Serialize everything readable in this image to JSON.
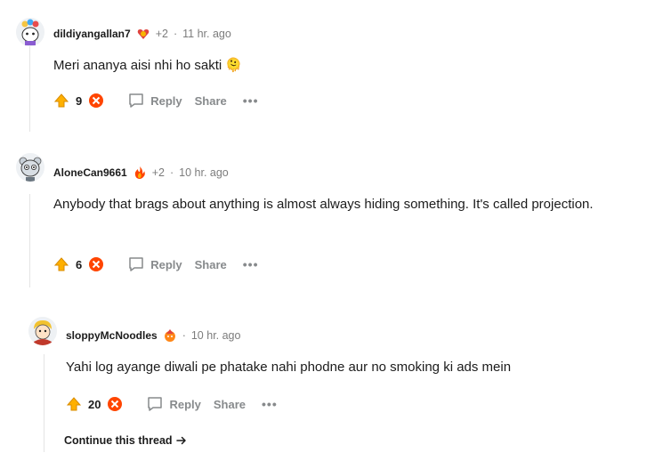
{
  "comments": [
    {
      "username": "dildiyangallan7",
      "award_extra": "+2",
      "separator": "·",
      "time": "11 hr. ago",
      "body": "Meri ananya aisi nhi ho sakti 🫠",
      "votes": "9",
      "reply_label": "Reply",
      "share_label": "Share",
      "more_label": "•••"
    },
    {
      "username": "AloneCan9661",
      "award_extra": "+2",
      "separator": "·",
      "time": "10 hr. ago",
      "body": "Anybody that brags about anything is almost always hiding something. It's called projection.",
      "votes": "6",
      "reply_label": "Reply",
      "share_label": "Share",
      "more_label": "•••"
    },
    {
      "username": "sloppyMcNoodles",
      "separator": "·",
      "time": "10 hr. ago",
      "body": "Yahi log ayange diwali pe phatake nahi phodne aur no smoking ki ads mein",
      "votes": "20",
      "reply_label": "Reply",
      "share_label": "Share",
      "more_label": "•••"
    }
  ],
  "continue_thread": "Continue this thread",
  "colors": {
    "upvote": "#ffb000",
    "downvote": "#ff4500",
    "muted": "#878a8c"
  }
}
